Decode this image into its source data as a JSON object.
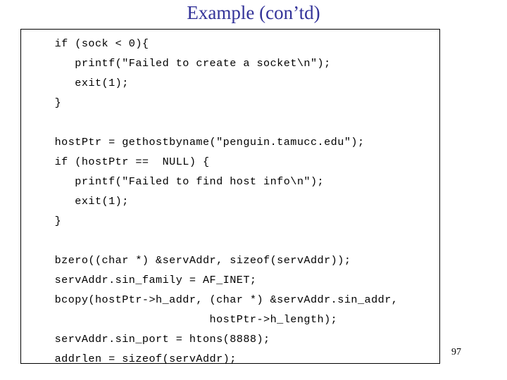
{
  "slide": {
    "title": "Example (con’td)",
    "title_color": "#333399",
    "background_color": "#ffffff",
    "page_number": "97",
    "code_text_color": "#000000",
    "code_box_border_color": "#000000"
  },
  "code": {
    "lines": [
      " if (sock < 0){",
      "    printf(\"Failed to create a socket\\n\");",
      "    exit(1);",
      " }",
      "",
      " hostPtr = gethostbyname(\"penguin.tamucc.edu\");",
      " if (hostPtr ==  NULL) {",
      "    printf(\"Failed to find host info\\n\");",
      "    exit(1);",
      " }",
      "",
      " bzero((char *) &servAddr, sizeof(servAddr));",
      " servAddr.sin_family = AF_INET;",
      " bcopy(hostPtr->h_addr, (char *) &servAddr.sin_addr,",
      "                        hostPtr->h_length);",
      " servAddr.sin_port = htons(8888);",
      " addrlen = sizeof(servAddr);"
    ]
  }
}
